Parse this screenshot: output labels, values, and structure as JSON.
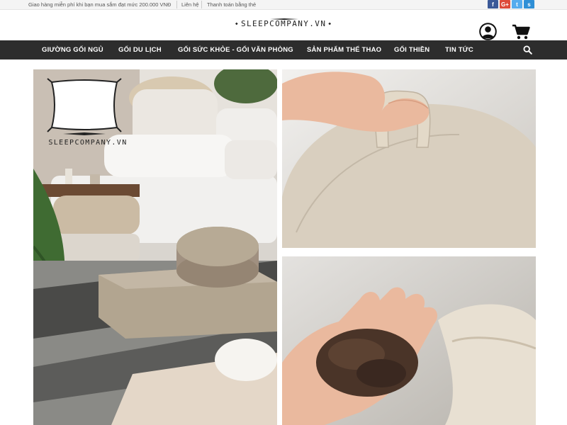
{
  "topbar": {
    "promo": "Giao hàng miễn phí khi bạn mua sắm đạt mức 200.000 VNĐ",
    "contact": "Liên hệ",
    "payment": "Thanh toán bằng thẻ",
    "social": [
      {
        "icon": "facebook-icon",
        "glyph": "f",
        "color": "#3b5998"
      },
      {
        "icon": "google-plus-icon",
        "glyph": "G+",
        "color": "#dd4b39"
      },
      {
        "icon": "twitter-icon",
        "glyph": "t",
        "color": "#55acee"
      },
      {
        "icon": "skype-icon",
        "glyph": "s",
        "color": "#2f8fd6"
      }
    ]
  },
  "header": {
    "logo": "SLEEPCOMPANY.VN",
    "user_icon": "user-icon",
    "cart_icon": "cart-icon"
  },
  "nav": {
    "items": [
      "GIƯỜNG GỐI NGỦ",
      "GỐI DU LỊCH",
      "GỐI SỨC KHỎE - GỐI VĂN PHÒNG",
      "SẢN PHẨM THỂ THAO",
      "GỐI THIỀN",
      "TIN TỨC"
    ],
    "search_icon": "search-icon"
  },
  "gallery": {
    "main_watermark": "SLEEPCOMPANY.VN"
  },
  "colors": {
    "nav_bg": "#2d2d2d",
    "topbar_bg": "#f4f4f4"
  }
}
